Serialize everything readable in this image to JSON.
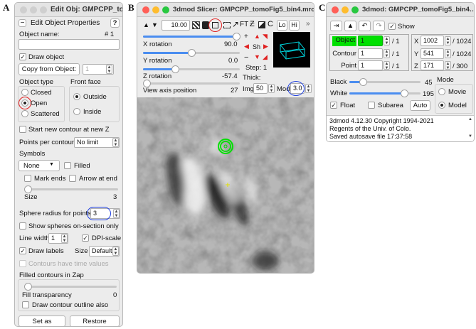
{
  "panels": {
    "a": "A",
    "b": "B",
    "c": "C"
  },
  "colors": {
    "close": "#ff5f57",
    "min": "#febc2e",
    "max": "#28c840",
    "inactive": "#cfcfcf",
    "red": "#e02020",
    "blue": "#1e3fe0",
    "green_sel": "#00e000",
    "accent": "#4a8df0"
  },
  "edit": {
    "title": "Edit Obj: GMPCPP_tom...",
    "header": "Edit Object Properties",
    "help": "?",
    "minus": "−",
    "object_name_label": "Object name:",
    "object_number": "# 1",
    "object_name_value": "",
    "draw_object": "Draw object",
    "copy_from": "Copy from Object:",
    "copy_value": "1",
    "object_type_label": "Object type",
    "front_face_label": "Front face",
    "type_closed": "Closed",
    "type_open": "Open",
    "type_scattered": "Scattered",
    "face_outside": "Outside",
    "face_inside": "Inside",
    "start_contour": "Start new contour at new Z",
    "points_label": "Points per contour",
    "points_value": "No limit",
    "symbols_label": "Symbols",
    "symbol_value": "None",
    "filled": "Filled",
    "mark_ends": "Mark ends",
    "arrow_end": "Arrow at end",
    "size_label": "Size",
    "size_value": "3",
    "sphere_label": "Sphere radius for points",
    "sphere_value": "3",
    "show_spheres": "Show spheres on-section only",
    "line_width_label": "Line width",
    "line_width_value": "1",
    "dpi_scale": "DPI-scale",
    "draw_labels": "Draw labels",
    "label_size_label": "Size",
    "label_size_value": "Default",
    "time_values": "Contours have time values",
    "filled_zap": "Filled contours in Zap",
    "fill_transparency_label": "Fill transparency",
    "fill_transparency_value": "0",
    "draw_outline": "Draw contour outline also",
    "set_defaults": "Set as Defaults",
    "restore": "Restore"
  },
  "slicer": {
    "title": "3dmod Slicer: GMPCPP_tomoFig5_bin4.mrc",
    "zoom": "10.00",
    "ft": "FT",
    "c_label": "C",
    "lo": "Lo",
    "hi": "Hi",
    "more": "»",
    "x_rot_label": "X rotation",
    "x_rot_value": "90.0",
    "y_rot_label": "Y rotation",
    "y_rot_value": "0.0",
    "z_rot_label": "Z rotation",
    "z_rot_value": "-57.4",
    "view_axis_label": "View axis position",
    "view_axis_value": "27",
    "sh": "Sh",
    "step": "Step: 1",
    "thick_label": "Thick:",
    "img_label": "Img",
    "img_value": "50",
    "mod_label": "Mod",
    "mod_value": "3.0"
  },
  "info": {
    "title": "3dmod: GMPCPP_tomoFig5_bin4....",
    "show": "Show",
    "object_label": "Object",
    "object_value": "1",
    "object_max": "/ 1",
    "contour_label": "Contour",
    "contour_value": "1",
    "contour_max": "/ 1",
    "point_label": "Point",
    "point_value": "1",
    "point_max": "/ 1",
    "x_label": "X",
    "x_value": "1002",
    "x_max": "/ 1024",
    "y_label": "Y",
    "y_value": "541",
    "y_max": "/ 1024",
    "z_label": "Z",
    "z_value": "171",
    "z_max": "/ 300",
    "black_label": "Black",
    "black_value": "45",
    "white_label": "White",
    "white_value": "195",
    "mode_label": "Mode",
    "movie": "Movie",
    "model": "Model",
    "float": "Float",
    "subarea": "Subarea",
    "auto": "Auto",
    "log_line1": "3dmod 4.12.30 Copyright 1994-2021",
    "log_line2": "Regents of the Univ. of Colo.",
    "log_line3": "Saved autosave file 17:37:58"
  }
}
